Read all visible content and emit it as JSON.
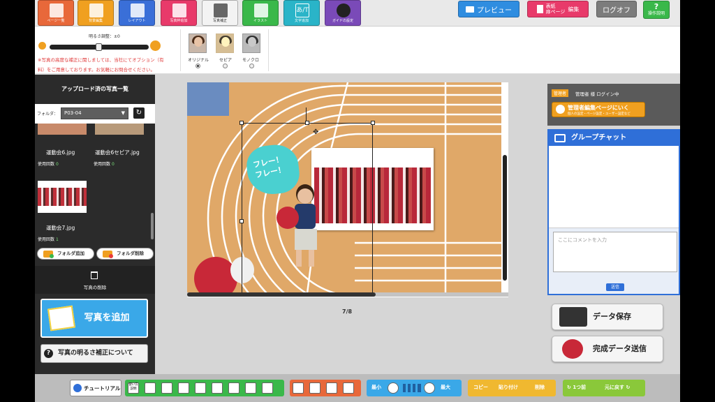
{
  "toolbar": {
    "tabs": [
      {
        "label": "ページ一覧",
        "color": "#e8683a"
      },
      {
        "label": "背景編集",
        "color": "#f0a020"
      },
      {
        "label": "レイアウト",
        "color": "#3a6fd8"
      },
      {
        "label": "写真枠追加",
        "color": "#e83a6a"
      },
      {
        "label": "写真補正",
        "color": "#f3f3f3"
      },
      {
        "label": "イラスト",
        "color": "#3ab84a"
      },
      {
        "label": "文字追加",
        "color": "#2ab4c8"
      },
      {
        "label": "ガイドの設定",
        "color": "#7a4ab8"
      }
    ],
    "preview_label": "プレビュー",
    "cover_label": "表紙\n扉ページ",
    "edit_label": "編集",
    "logout_label": "ログオフ",
    "help_label": "操作説明"
  },
  "subtoolbar": {
    "brightness_label": "明るさ調整：±0",
    "note_line1": "※写真の高度な補正に関しましては、当社にてオプション（有",
    "note_line2": "料）をご用意しております。お気軽にお問合せください。",
    "filters": [
      {
        "label": "オリジナル",
        "selected": true
      },
      {
        "label": "セピア",
        "selected": false
      },
      {
        "label": "モノクロ",
        "selected": false
      }
    ]
  },
  "left_panel": {
    "title": "アップロード済の写真一覧",
    "folder_label": "フォルダ：",
    "folder_value": "P03-04",
    "photos": [
      {
        "name": "運動会6.jpg",
        "use_label": "使用回数",
        "use_count": "0"
      },
      {
        "name": "運動会6セピア.jpg",
        "use_label": "使用回数",
        "use_count": "0"
      },
      {
        "name": "運動会7.jpg",
        "use_label": "使用回数",
        "use_count": "1"
      }
    ],
    "add_folder": "フォルダ追加",
    "delete_folder": "フォルダ削除",
    "delete_photo": "写真の削除",
    "add_photo": "写真を追加",
    "brightness_info": "写真の明るさ補正について"
  },
  "canvas": {
    "speech_bubble": "フレー！\nフレー！",
    "page_indicator": "7/8"
  },
  "right_panel": {
    "admin_tag": "管理者",
    "admin_text": "管理者 様 ログイン中",
    "admin_button": "管理者編集ページにいく",
    "admin_button_sub": "個人の設定・ページ設定・ユーザー設定など",
    "chat_title": "グループチャット",
    "chat_placeholder": "ここにコメントを入力",
    "send_label": "送信",
    "save_label": "データ保存",
    "submit_label": "完成データ送信"
  },
  "bottom_bar": {
    "tutorial": "チュートリアル",
    "align_label": "使い方\n説明",
    "zoom_min": "最小",
    "zoom_max": "最大",
    "copy": "コピー",
    "paste": "貼り付け",
    "delete": "削除",
    "undo": "1つ前",
    "redo": "元に戻す"
  }
}
